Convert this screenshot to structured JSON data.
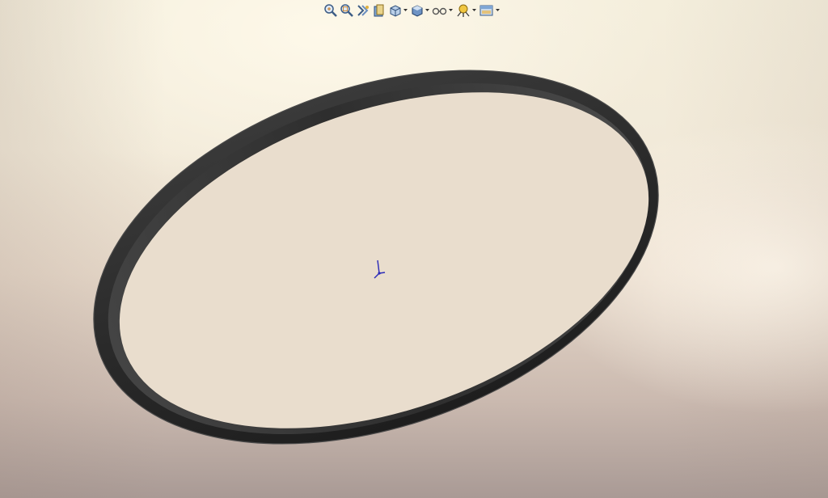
{
  "viewport": {
    "background_top": "#f4eedc",
    "background_bottom": "#a99a95"
  },
  "toolbar": {
    "items": [
      {
        "name": "zoom-to-fit-icon",
        "has_dropdown": false
      },
      {
        "name": "zoom-to-area-icon",
        "has_dropdown": false
      },
      {
        "name": "previous-view-icon",
        "has_dropdown": false
      },
      {
        "name": "section-view-icon",
        "has_dropdown": false
      },
      {
        "name": "view-orientation-icon",
        "has_dropdown": true
      },
      {
        "name": "display-style-icon",
        "has_dropdown": true
      },
      {
        "name": "hide-show-items-icon",
        "has_dropdown": true
      },
      {
        "name": "edit-appearance-icon",
        "has_dropdown": true
      },
      {
        "name": "apply-scene-icon",
        "has_dropdown": true
      }
    ]
  },
  "model": {
    "type": "ring",
    "color": "#2b2b2b",
    "edge_color": "#3a3a3a"
  },
  "origin_triad": {
    "color": "#2a2ab8"
  }
}
